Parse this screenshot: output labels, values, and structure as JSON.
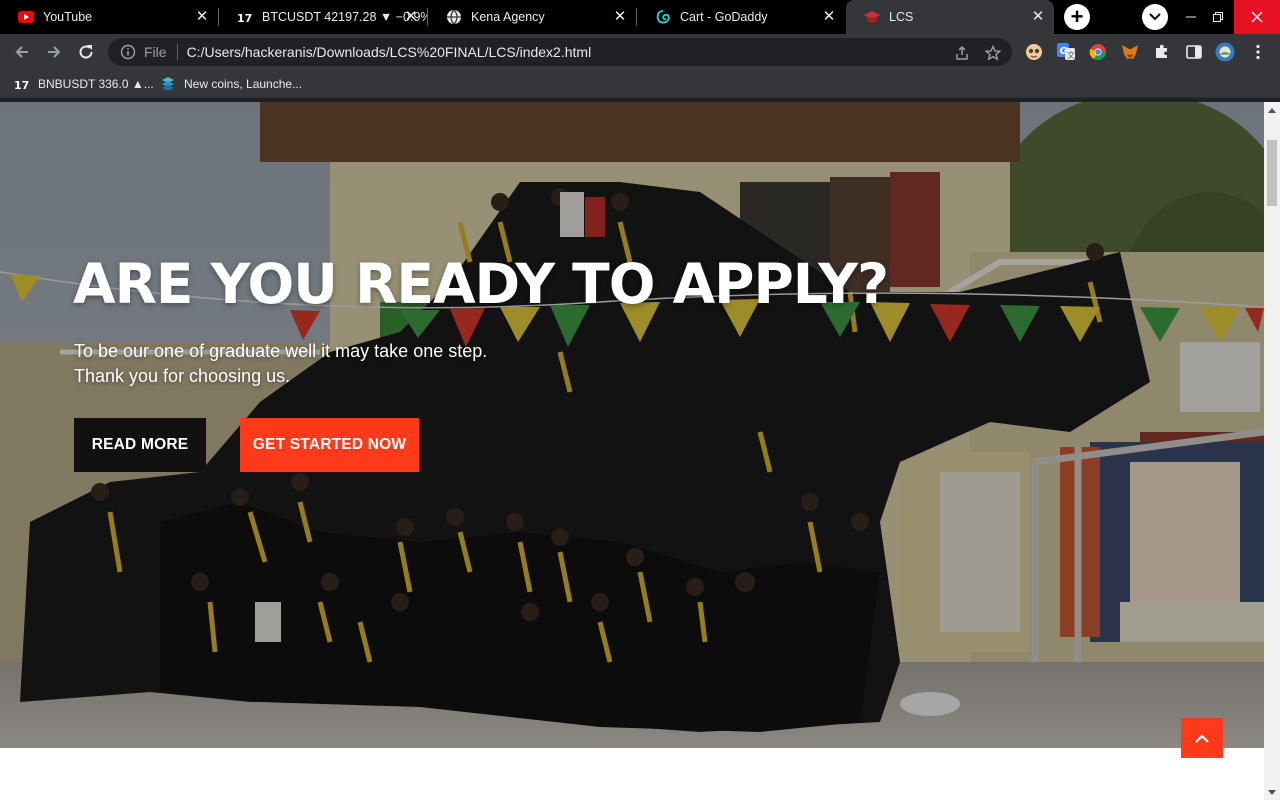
{
  "browser": {
    "tabs": [
      {
        "title": "YouTube",
        "icon": "youtube-icon"
      },
      {
        "title": "BTCUSDT 42197.28 ▼ −0.9%",
        "icon": "tradingview-icon"
      },
      {
        "title": "Kena Agency",
        "icon": "globe-icon"
      },
      {
        "title": "Cart - GoDaddy",
        "icon": "godaddy-icon"
      },
      {
        "title": "LCS",
        "icon": "graduation-cap-icon",
        "active": true
      }
    ],
    "address": {
      "scheme_label": "File",
      "url": "C:/Users/hackeranis/Downloads/LCS%20FINAL/LCS/index2.html"
    },
    "bookmarks": [
      {
        "label": "BNBUSDT 336.0 ▲...",
        "icon": "tradingview-icon"
      },
      {
        "label": "New coins, Launche...",
        "icon": "coin-icon"
      }
    ],
    "colors": {
      "tabstrip": "#000000",
      "toolbar": "#35363a",
      "omnibox": "#202124",
      "close_window": "#e81123"
    }
  },
  "page": {
    "hero": {
      "title": "ARE YOU READY TO APPLY?",
      "subtitle_line1": "To be our one of graduate well it may take one step.",
      "subtitle_line2": "Thank you for choosing us.",
      "read_more_label": "READ MORE",
      "get_started_label": "GET STARTED NOW"
    },
    "colors": {
      "accent": "#ff3a1a",
      "dark_button": "#111111",
      "text": "#ffffff"
    }
  }
}
